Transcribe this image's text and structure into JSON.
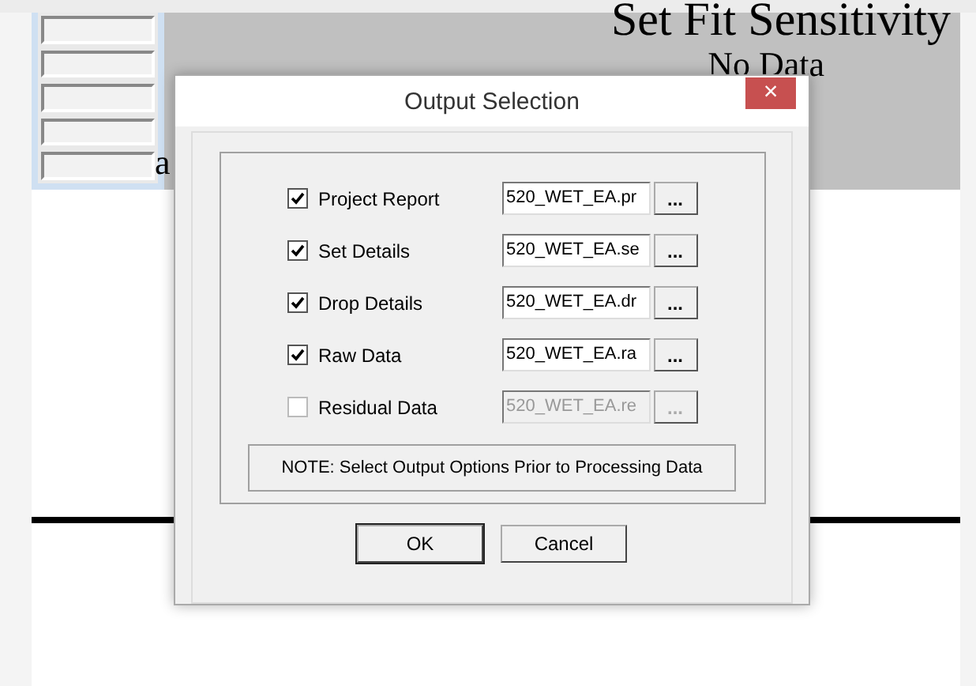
{
  "background": {
    "title": "Set Fit Sensitivity",
    "subtitle": "No Data",
    "side_label": "a"
  },
  "dialog": {
    "title": "Output Selection",
    "close": "×",
    "options": [
      {
        "label": "Project Report",
        "checked": true,
        "file": "520_WET_EA.pr",
        "browse": "...",
        "disabled": false
      },
      {
        "label": "Set Details",
        "checked": true,
        "file": "520_WET_EA.se",
        "browse": "...",
        "disabled": false
      },
      {
        "label": "Drop Details",
        "checked": true,
        "file": "520_WET_EA.dr",
        "browse": "...",
        "disabled": false
      },
      {
        "label": "Raw Data",
        "checked": true,
        "file": "520_WET_EA.ra",
        "browse": "...",
        "disabled": false
      },
      {
        "label": "Residual Data",
        "checked": false,
        "file": "520_WET_EA.re",
        "browse": "...",
        "disabled": true
      }
    ],
    "note": "NOTE:  Select Output Options Prior to Processing Data",
    "buttons": [
      "OK",
      "Cancel"
    ]
  }
}
